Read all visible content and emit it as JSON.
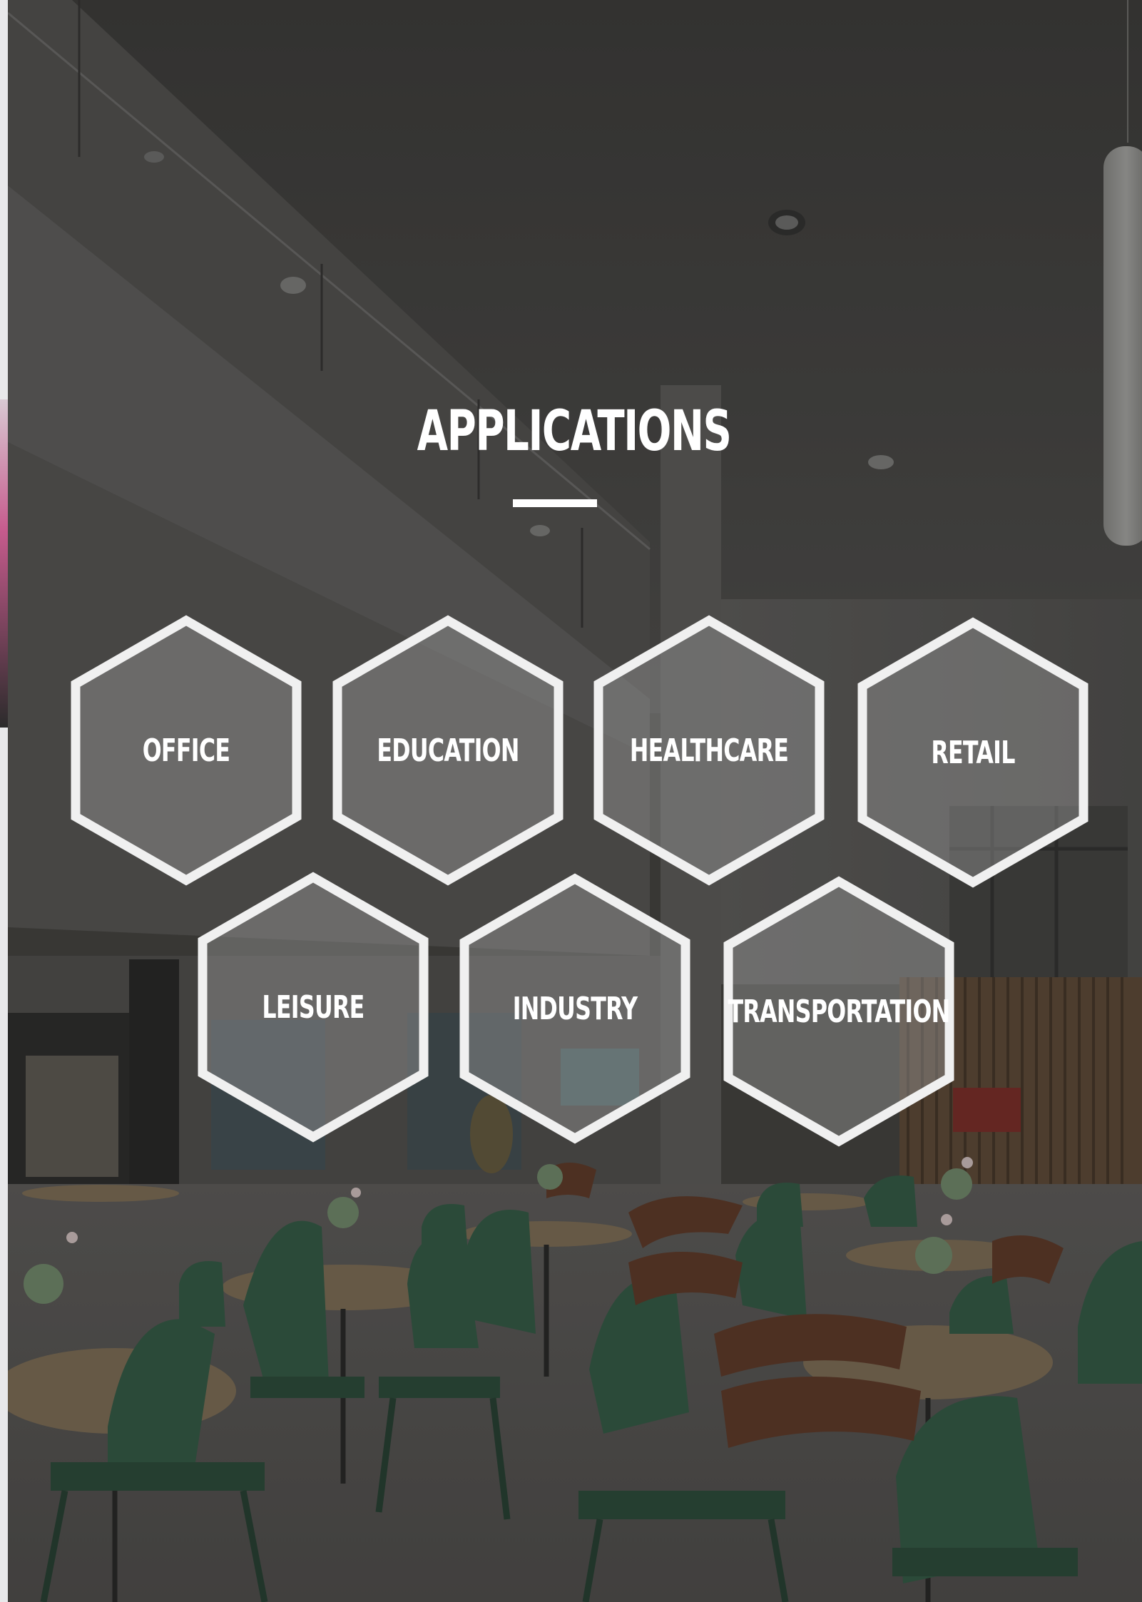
{
  "page": {
    "title": "APPLICATIONS"
  },
  "applications": [
    {
      "label": "OFFICE"
    },
    {
      "label": "EDUCATION"
    },
    {
      "label": "HEALTHCARE"
    },
    {
      "label": "RETAIL"
    },
    {
      "label": "LEISURE"
    },
    {
      "label": "INDUSTRY"
    },
    {
      "label": "TRANSPORTATION"
    }
  ],
  "colors": {
    "overlay": "#3d3c3a",
    "hex_outline": "#f0f0f0",
    "hex_fill": "rgba(150,150,150,0.45)",
    "text": "#ffffff",
    "chair_green": "#2f5a42",
    "table_wood": "#b79c74"
  },
  "background": {
    "image_subject": "cafeteria-interior-photo"
  }
}
